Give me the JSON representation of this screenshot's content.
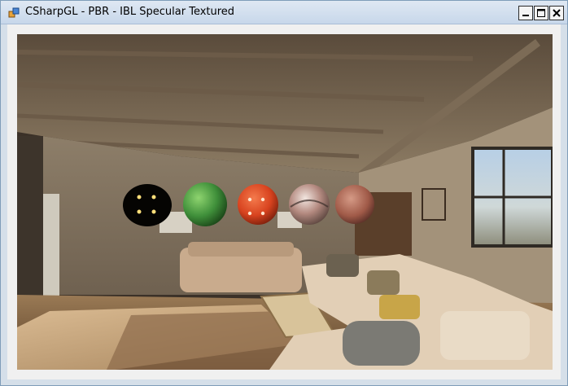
{
  "window": {
    "title": "CSharpGL - PBR - IBL Specular Textured",
    "icon": "csharpgl-app-icon",
    "controls": [
      "minimize",
      "maximize",
      "close"
    ]
  },
  "scene": {
    "description_icon": "ibl-render-viewport",
    "spheres": [
      {
        "material": "dark-emissive",
        "color": "#050402"
      },
      {
        "material": "grass",
        "color": "#3f8f3a"
      },
      {
        "material": "orange-plastic",
        "color": "#d8431f"
      },
      {
        "material": "rusted-metal",
        "color": "#b48a80"
      },
      {
        "material": "rust",
        "color": "#a05a48"
      }
    ]
  }
}
